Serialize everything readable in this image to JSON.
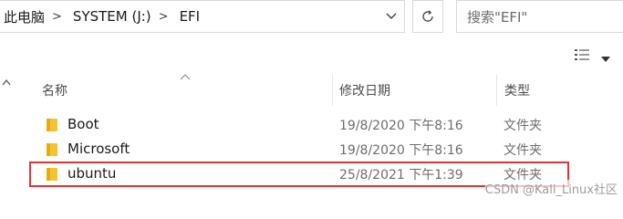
{
  "address_bar": {
    "crumbs": [
      "此电脑",
      "SYSTEM (J:)",
      "EFI"
    ],
    "separator": ">"
  },
  "search": {
    "placeholder": "搜索\"EFI\""
  },
  "columns": {
    "name": "名称",
    "date": "修改日期",
    "type": "类型"
  },
  "rows": [
    {
      "name": "Boot",
      "date": "19/8/2020 下午8:16",
      "type": "文件夹"
    },
    {
      "name": "Microsoft",
      "date": "19/8/2020 下午8:16",
      "type": "文件夹"
    },
    {
      "name": "ubuntu",
      "date": "25/8/2021 下午1:39",
      "type": "文件夹"
    }
  ],
  "watermark": "CSDN @Kali_Linux社区",
  "colors": {
    "folder": "#f4c430",
    "highlight_border": "#d9383a",
    "muted_text": "#6d6d6d"
  },
  "icons": {
    "folder": "folder-icon",
    "refresh": "refresh-icon",
    "dropdown": "chevron-down-icon",
    "view": "details-view-icon"
  }
}
